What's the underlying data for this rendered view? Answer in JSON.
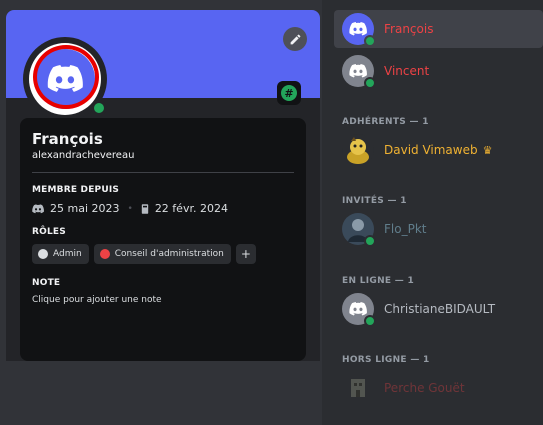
{
  "profile": {
    "display_name": "François",
    "username": "alexandrachevereau",
    "member_since_title": "MEMBRE DEPUIS",
    "discord_date": "25 mai 2023",
    "server_date": "22 févr. 2024",
    "roles_title": "RÔLES",
    "roles": [
      {
        "label": "Admin",
        "color": "#dbdee1"
      },
      {
        "label": "Conseil d'administration",
        "color": "#ed4245"
      }
    ],
    "add_role_label": "+",
    "note_title": "NOTE",
    "note_placeholder": "Clique pour ajouter une note",
    "nitro_badge": "#",
    "banner_color": "#5865f2"
  },
  "member_list": {
    "top_members": [
      {
        "name": "François",
        "color": "#ed4245",
        "avatar_color": "#5865f2",
        "icon": "discord-logo-icon"
      },
      {
        "name": "Vincent",
        "color": "#ed4245",
        "avatar_color": "#80848e",
        "icon": "discord-logo-icon"
      }
    ],
    "groups": [
      {
        "header": "ADHÉRENTS — 1",
        "member": {
          "name": "David Vimaweb",
          "color": "#f0b232",
          "crown": "♛"
        }
      },
      {
        "header": "INVITÉS — 1",
        "member": {
          "name": "Flo_Pkt",
          "color": "#607d8b"
        }
      },
      {
        "header": "EN LIGNE — 1",
        "member": {
          "name": "ChristianeBIDAULT",
          "color": "#b5bac1"
        }
      },
      {
        "header": "HORS LIGNE — 1",
        "member": {
          "name": "Perche Gouët",
          "color": "#5a3234"
        }
      }
    ]
  }
}
